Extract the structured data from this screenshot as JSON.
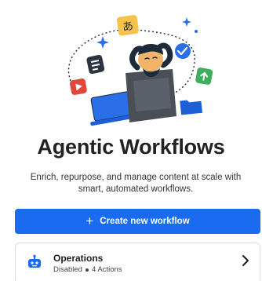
{
  "hero": {
    "glyph": "あ"
  },
  "page": {
    "title": "Agentic Workflows",
    "subtitle": "Enrich, repurpose, and manage content at scale with smart, automated workflows."
  },
  "create_button": {
    "icon": "plus-icon",
    "plus": "+",
    "label": "Create new workflow"
  },
  "workflows": [
    {
      "name": "Operations",
      "status": "Disabled",
      "actions": "4 Actions",
      "icon": "robot-icon"
    }
  ],
  "colors": {
    "accent": "#1a6bf0",
    "title": "#222222"
  }
}
